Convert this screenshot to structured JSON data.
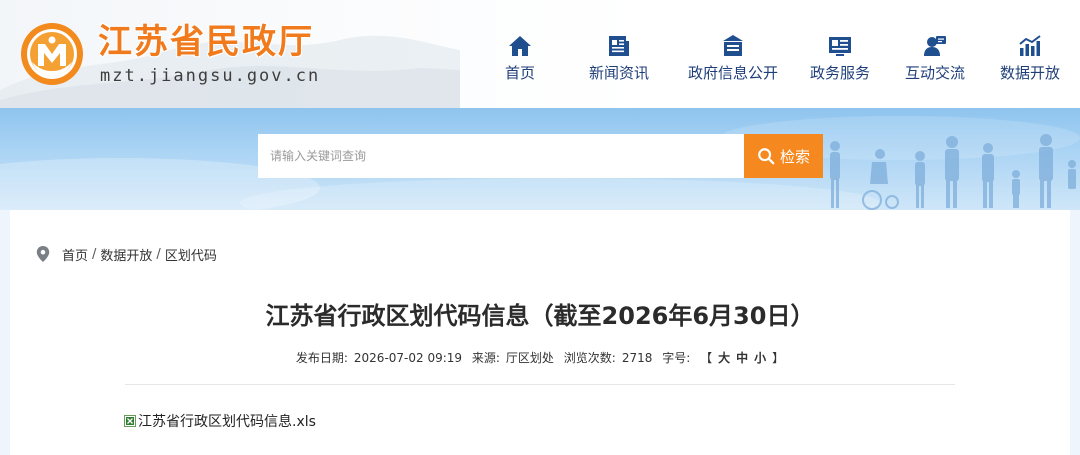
{
  "header": {
    "site_title": "江苏省民政厅",
    "site_domain": "mzt.jiangsu.gov.cn",
    "logo_icon": "civil-affairs-emblem-icon"
  },
  "nav": {
    "items": [
      {
        "label": "首页",
        "icon": "home-icon"
      },
      {
        "label": "新闻资讯",
        "icon": "news-icon"
      },
      {
        "label": "政府信息公开",
        "icon": "gov-info-icon"
      },
      {
        "label": "政务服务",
        "icon": "service-icon"
      },
      {
        "label": "互动交流",
        "icon": "interaction-icon"
      },
      {
        "label": "数据开放",
        "icon": "data-chart-icon"
      }
    ]
  },
  "search": {
    "placeholder": "请输入关键词查询",
    "button_label": "检索"
  },
  "breadcrumb": {
    "items": [
      "首页",
      "数据开放",
      "区划代码"
    ],
    "separator": "/"
  },
  "article": {
    "title": "江苏省行政区划代码信息（截至2026年6月30日）",
    "meta": {
      "publish_label": "发布日期:",
      "publish_date": "2026-07-02 09:19",
      "source_label": "来源:",
      "source": "厅区划处",
      "views_label": "浏览次数:",
      "views": "2718",
      "font_label": "字号:",
      "bracket_open": "【",
      "size_large": "大",
      "size_medium": "中",
      "size_small": "小",
      "bracket_close": "】"
    },
    "attachment": {
      "name": "江苏省行政区划代码信息.xls"
    }
  },
  "colors": {
    "brand_orange": "#f5891f",
    "title_orange": "#f07a1c",
    "nav_blue": "#1f3f7a",
    "banner_blue": "#8fc4ee"
  }
}
